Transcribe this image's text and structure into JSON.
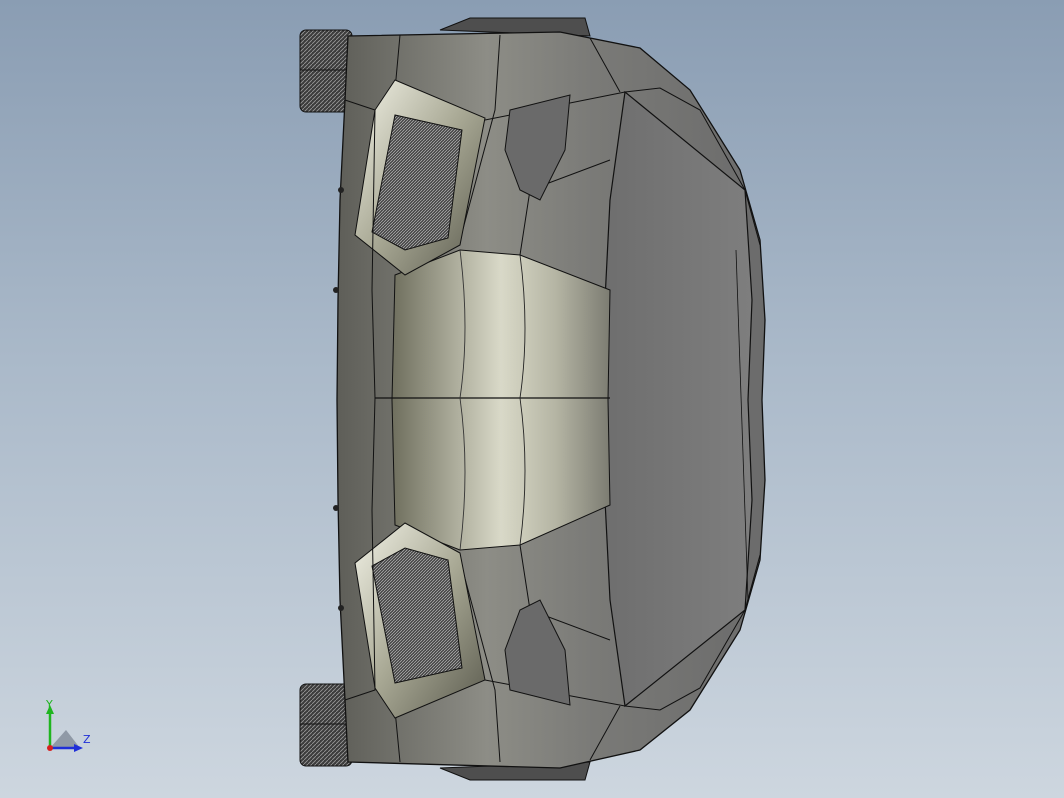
{
  "viewport": {
    "background_top": "#8a9db3",
    "background_bottom": "#cdd6df"
  },
  "model": {
    "body_color": "#7d7d7d",
    "edge_color": "#111111"
  },
  "triad": {
    "y_label": "Y",
    "z_label": "Z",
    "y_color": "#1fb51f",
    "z_color": "#1f2fd8",
    "x_color": "#d81f1f"
  }
}
